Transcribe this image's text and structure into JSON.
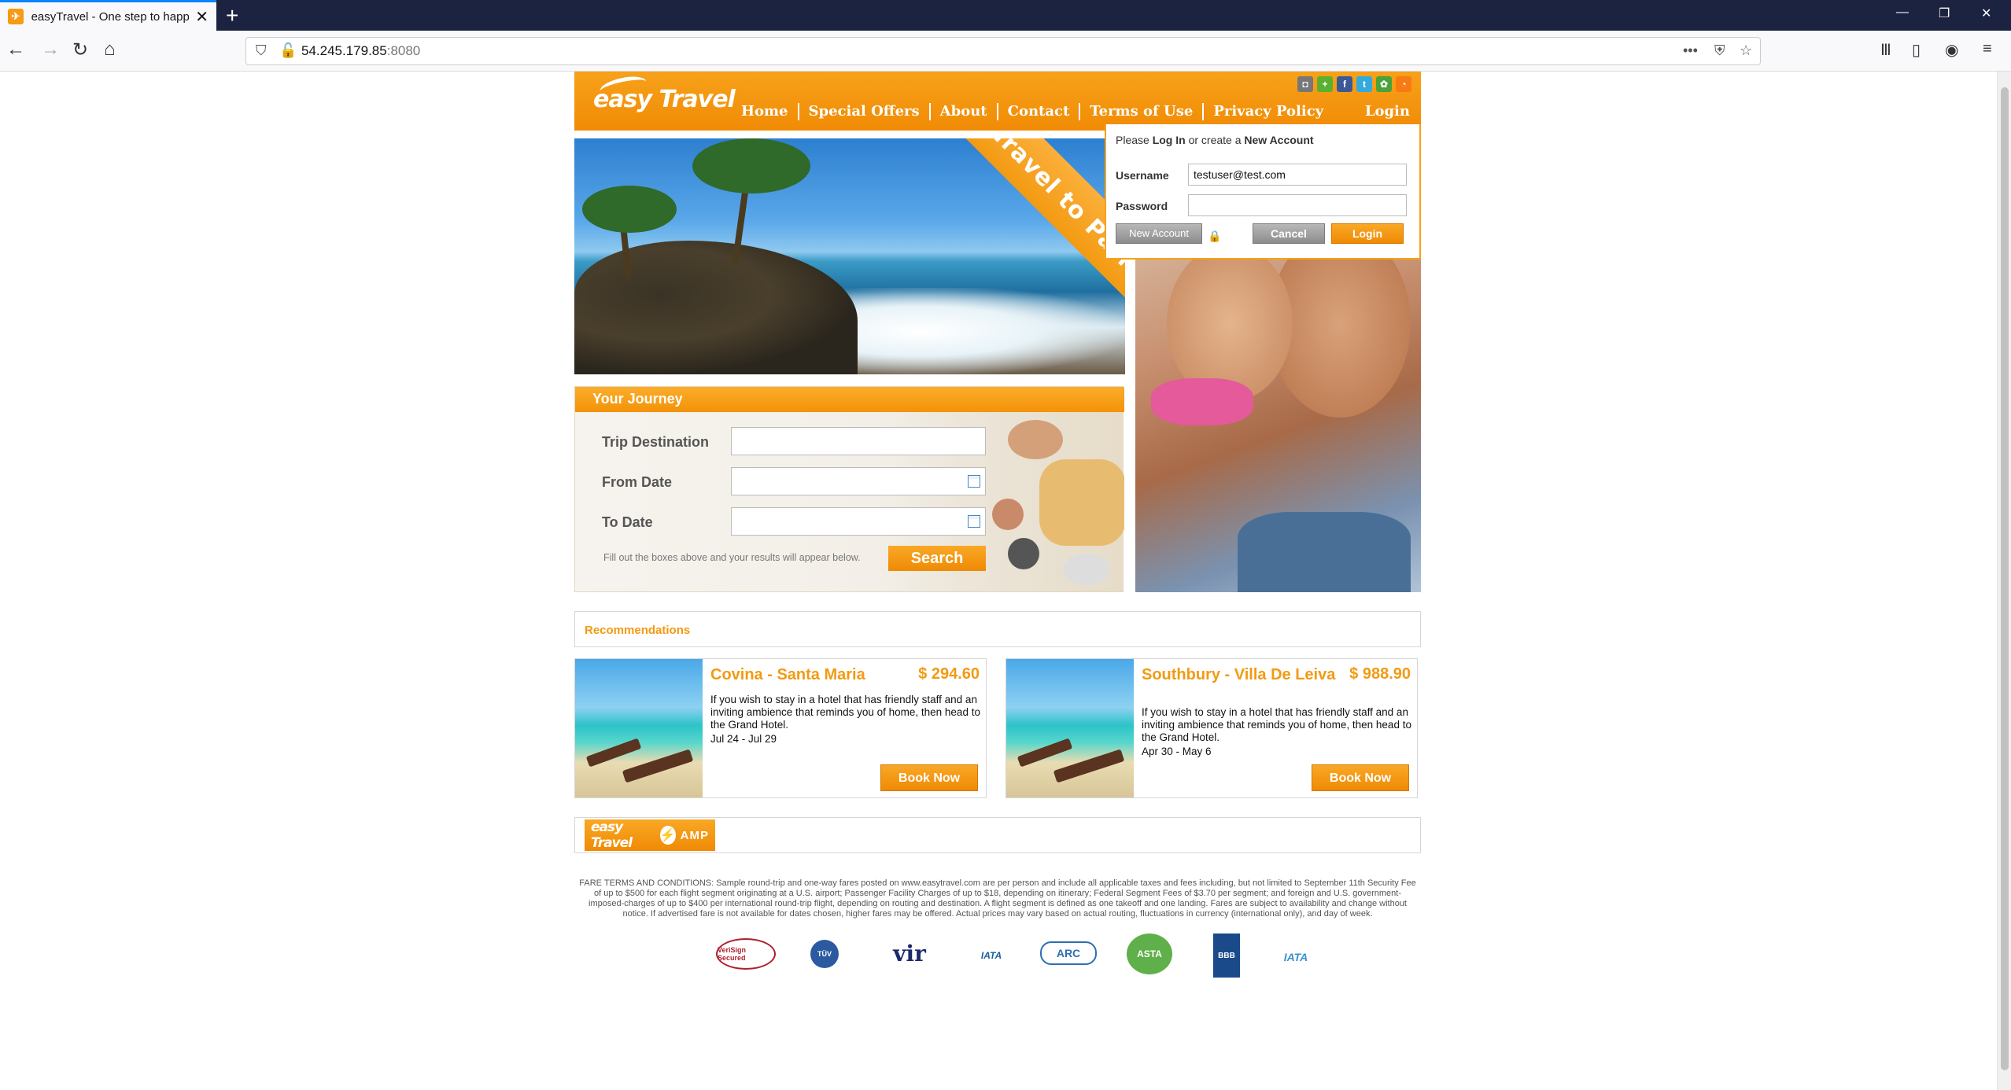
{
  "browser": {
    "tab_title": "easyTravel - One step to happi",
    "tab_favicon": "plane-icon",
    "new_tab": "+",
    "url_host": "54.245.179.85",
    "url_port": ":8080",
    "controls": {
      "minimize": "—",
      "restore": "❐",
      "close": "✕"
    }
  },
  "header": {
    "logo": "easy Travel",
    "menu": [
      "Home",
      "Special Offers",
      "About",
      "Contact",
      "Terms of Use",
      "Privacy Policy"
    ],
    "login": "Login",
    "social": [
      "camera-icon",
      "plus-icon",
      "facebook-icon",
      "twitter-icon",
      "flickr-icon",
      "rss-icon"
    ]
  },
  "hero": {
    "ribbon": "Travel to Pari"
  },
  "login_box": {
    "prompt_a": "Please ",
    "prompt_login": "Log In",
    "prompt_b": " or create a ",
    "prompt_new": "New Account",
    "username_label": "Username",
    "username_value": "testuser@test.com",
    "password_label": "Password",
    "password_value": "",
    "new_account": "New Account",
    "cancel": "Cancel",
    "login": "Login"
  },
  "journey": {
    "title": "Your Journey",
    "destination_label": "Trip Destination",
    "from_label": "From Date",
    "to_label": "To Date",
    "hint": "Fill out the boxes above and your results will appear below.",
    "search": "Search"
  },
  "recommendations": {
    "title": "Recommendations",
    "cards": [
      {
        "title": "Covina - Santa Maria",
        "price": "$ 294.60",
        "desc": "If you wish to stay in a hotel that has friendly staff and an inviting ambience that reminds you of home, then head to the Grand Hotel.",
        "dates": "Jul 24 - Jul 29",
        "button": "Book Now"
      },
      {
        "title": "Southbury - Villa De Leiva",
        "price": "$ 988.90",
        "desc": "If you wish to stay in a hotel that has friendly staff and an inviting ambience that reminds you of home, then head to the Grand Hotel.",
        "dates": "Apr 30 - May 6",
        "button": "Book Now"
      }
    ]
  },
  "amp": {
    "logo": "easy Travel",
    "bolt": "⚡",
    "label": "AMP"
  },
  "fare_terms": "FARE TERMS AND CONDITIONS: Sample round-trip and one-way fares posted on www.easytravel.com are per person and include all applicable taxes and fees including, but not limited to September 11th Security Fee of up to $500 for each flight segment originating at a U.S. airport; Passenger Facility Charges of up to $18, depending on itinerary; Federal Segment Fees of $3.70 per segment; and foreign and U.S. government-imposed-charges of up to $400 per international round-trip flight, depending on routing and destination. A flight segment is defined as one takeoff and one landing. Fares are subject to availability and change without notice. If advertised fare is not available for dates chosen, higher fares may be offered. Actual prices may vary based on actual routing, fluctuations in currency (international only), and day of week.",
  "badges": {
    "verisign": "VeriSign Secured",
    "tuv": "TÜV",
    "vir": "vir",
    "iata1": "IATA",
    "arc": "ARC",
    "asta": "ASTA",
    "bbb": "BBB",
    "iata2": "IATA"
  }
}
